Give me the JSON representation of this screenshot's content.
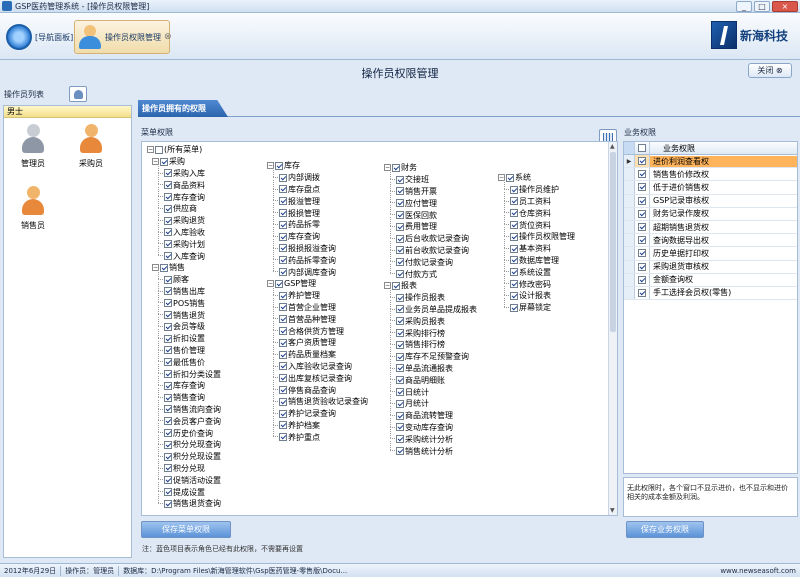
{
  "window": {
    "title": "GSP医药管理系统 - [操作员权限管理]",
    "controls": [
      "_",
      "□",
      "×"
    ]
  },
  "nav": {
    "tab1": "[导航面板]",
    "tab2": "操作员权限管理"
  },
  "brand": {
    "name": "新海科技"
  },
  "page": {
    "title": "操作员权限管理",
    "close_label": "关闭"
  },
  "left": {
    "header": "操作员列表",
    "group": "男士",
    "users": [
      "管理员",
      "采购员",
      "销售员"
    ]
  },
  "main": {
    "tab": "操作员拥有的权限",
    "menu_label": "菜单权限",
    "biz_label": "业务权限",
    "save_menu": "保存菜单权限",
    "save_biz": "保存业务权限",
    "note": "注：蓝色项目表示角色已经有此权限，不需要再设置",
    "biz_desc": "无此权限时，各个窗口不显示进价，也不显示和进价相关的成本金额及利润。"
  },
  "tree": {
    "root": "(所有菜单)",
    "col1": [
      {
        "name": "采购",
        "items": [
          "采购入库",
          "商品资料",
          "库存查询",
          "供应商",
          "采购退货",
          "入库验收",
          "采购计划",
          "入库查询"
        ]
      },
      {
        "name": "销售",
        "items": [
          "顾客",
          "销售出库",
          "POS销售",
          "销售退货",
          "会员等级",
          "折扣设置",
          "售价管理",
          "最低售价",
          "折扣分类设置",
          "库存查询",
          "销售查询",
          "销售流向查询",
          "会员客户查询",
          "历史价查询",
          "积分兑现查询",
          "积分兑现设置",
          "积分兑现",
          "促销活动设置",
          "提成设置",
          "销售退货查询"
        ]
      }
    ],
    "col2": [
      {
        "name": "库存",
        "items": [
          "内部调拨",
          "库存盘点",
          "报溢管理",
          "报损管理",
          "药品拆零",
          "库存查询",
          "报损报溢查询",
          "药品拆零查询",
          "内部调库查询"
        ]
      },
      {
        "name": "GSP管理",
        "items": [
          "养护管理",
          "首营企业管理",
          "首营品种管理",
          "合格供货方管理",
          "客户资质管理",
          "药品质量档案",
          "入库验收记录查询",
          "出库复核记录查询",
          "停售商品查询",
          "销售退货验收记录查询",
          "养护记录查询",
          "养护档案",
          "养护重点"
        ]
      }
    ],
    "col3": [
      {
        "name": "财务",
        "items": [
          "交接班",
          "销售开票",
          "应付管理",
          "医保回款",
          "费用管理",
          "后台收款记录查询",
          "前台收款记录查询",
          "付款记录查询",
          "付款方式"
        ]
      },
      {
        "name": "报表",
        "items": [
          "操作员报表",
          "业务员单品提成报表",
          "采购员报表",
          "采购排行榜",
          "销售排行榜",
          "库存不足预警查询",
          "单品流通报表",
          "商品明细账",
          "日统计",
          "月统计",
          "商品流转管理",
          "变动库存查询",
          "采购统计分析",
          "销售统计分析"
        ]
      }
    ],
    "col4": [
      {
        "name": "系统",
        "items": [
          "操作员维护",
          "员工资料",
          "仓库资料",
          "货位资料",
          "操作员权限管理",
          "基本资料",
          "数据库管理",
          "系统设置",
          "修改密码",
          "设计报表",
          "屏幕锁定"
        ]
      }
    ]
  },
  "biz": {
    "header": "业务权限",
    "rows": [
      "进价利润查看权",
      "销售售价修改权",
      "低于进价销售权",
      "GSP记录审核权",
      "财务记录作废权",
      "超期销售退货权",
      "查询数据导出权",
      "历史单据打印权",
      "采购退货审核权",
      "金额查询权",
      "手工选择会员权(零售)"
    ]
  },
  "status": {
    "date": "2012年6月29日",
    "operator": "操作员：管理员",
    "db": "数据库：D:\\Program Files\\新海管理软件\\Gsp医药管理-零售版\\Docu...",
    "site": "www.newseasoft.com"
  },
  "colors": {
    "accent": "#2b64ad",
    "selected_row": "#ffb35a",
    "panel_bg": "#dfe9f5"
  }
}
